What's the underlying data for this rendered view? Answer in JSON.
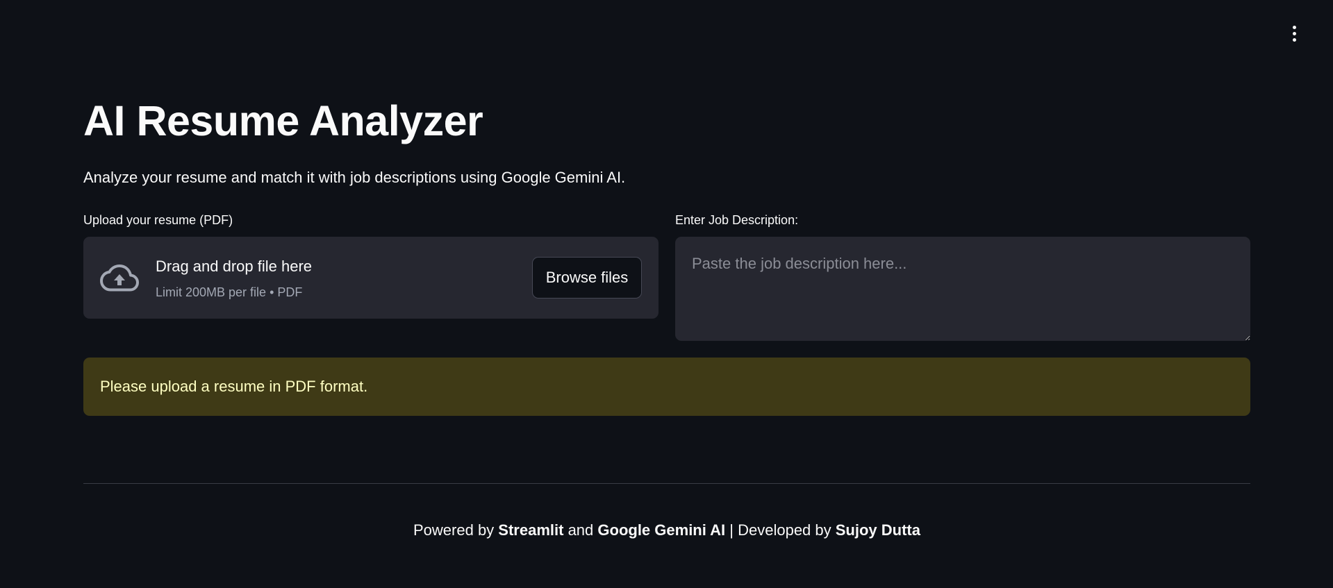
{
  "header": {
    "menu_icon": "kebab-vertical-icon"
  },
  "page": {
    "title": "AI Resume Analyzer",
    "subtitle": "Analyze your resume and match it with job descriptions using Google Gemini AI."
  },
  "uploader": {
    "label": "Upload your resume (PDF)",
    "icon": "cloud-upload-icon",
    "title": "Drag and drop file here",
    "limit": "Limit 200MB per file • PDF",
    "button_label": "Browse files"
  },
  "job_description": {
    "label": "Enter Job Description:",
    "placeholder": "Paste the job description here...",
    "value": ""
  },
  "alert": {
    "type": "warning",
    "message": "Please upload a resume in PDF format."
  },
  "footer": {
    "part1": "Powered by ",
    "brand1": "Streamlit",
    "part2": " and ",
    "brand2": "Google Gemini AI",
    "part3": " | Developed by ",
    "author": "Sujoy Dutta"
  },
  "colors": {
    "background": "#0e1117",
    "surface": "#262730",
    "warning_bg": "#3f3a16",
    "warning_text": "#ffffc2",
    "muted_text": "#a3a8b4"
  }
}
